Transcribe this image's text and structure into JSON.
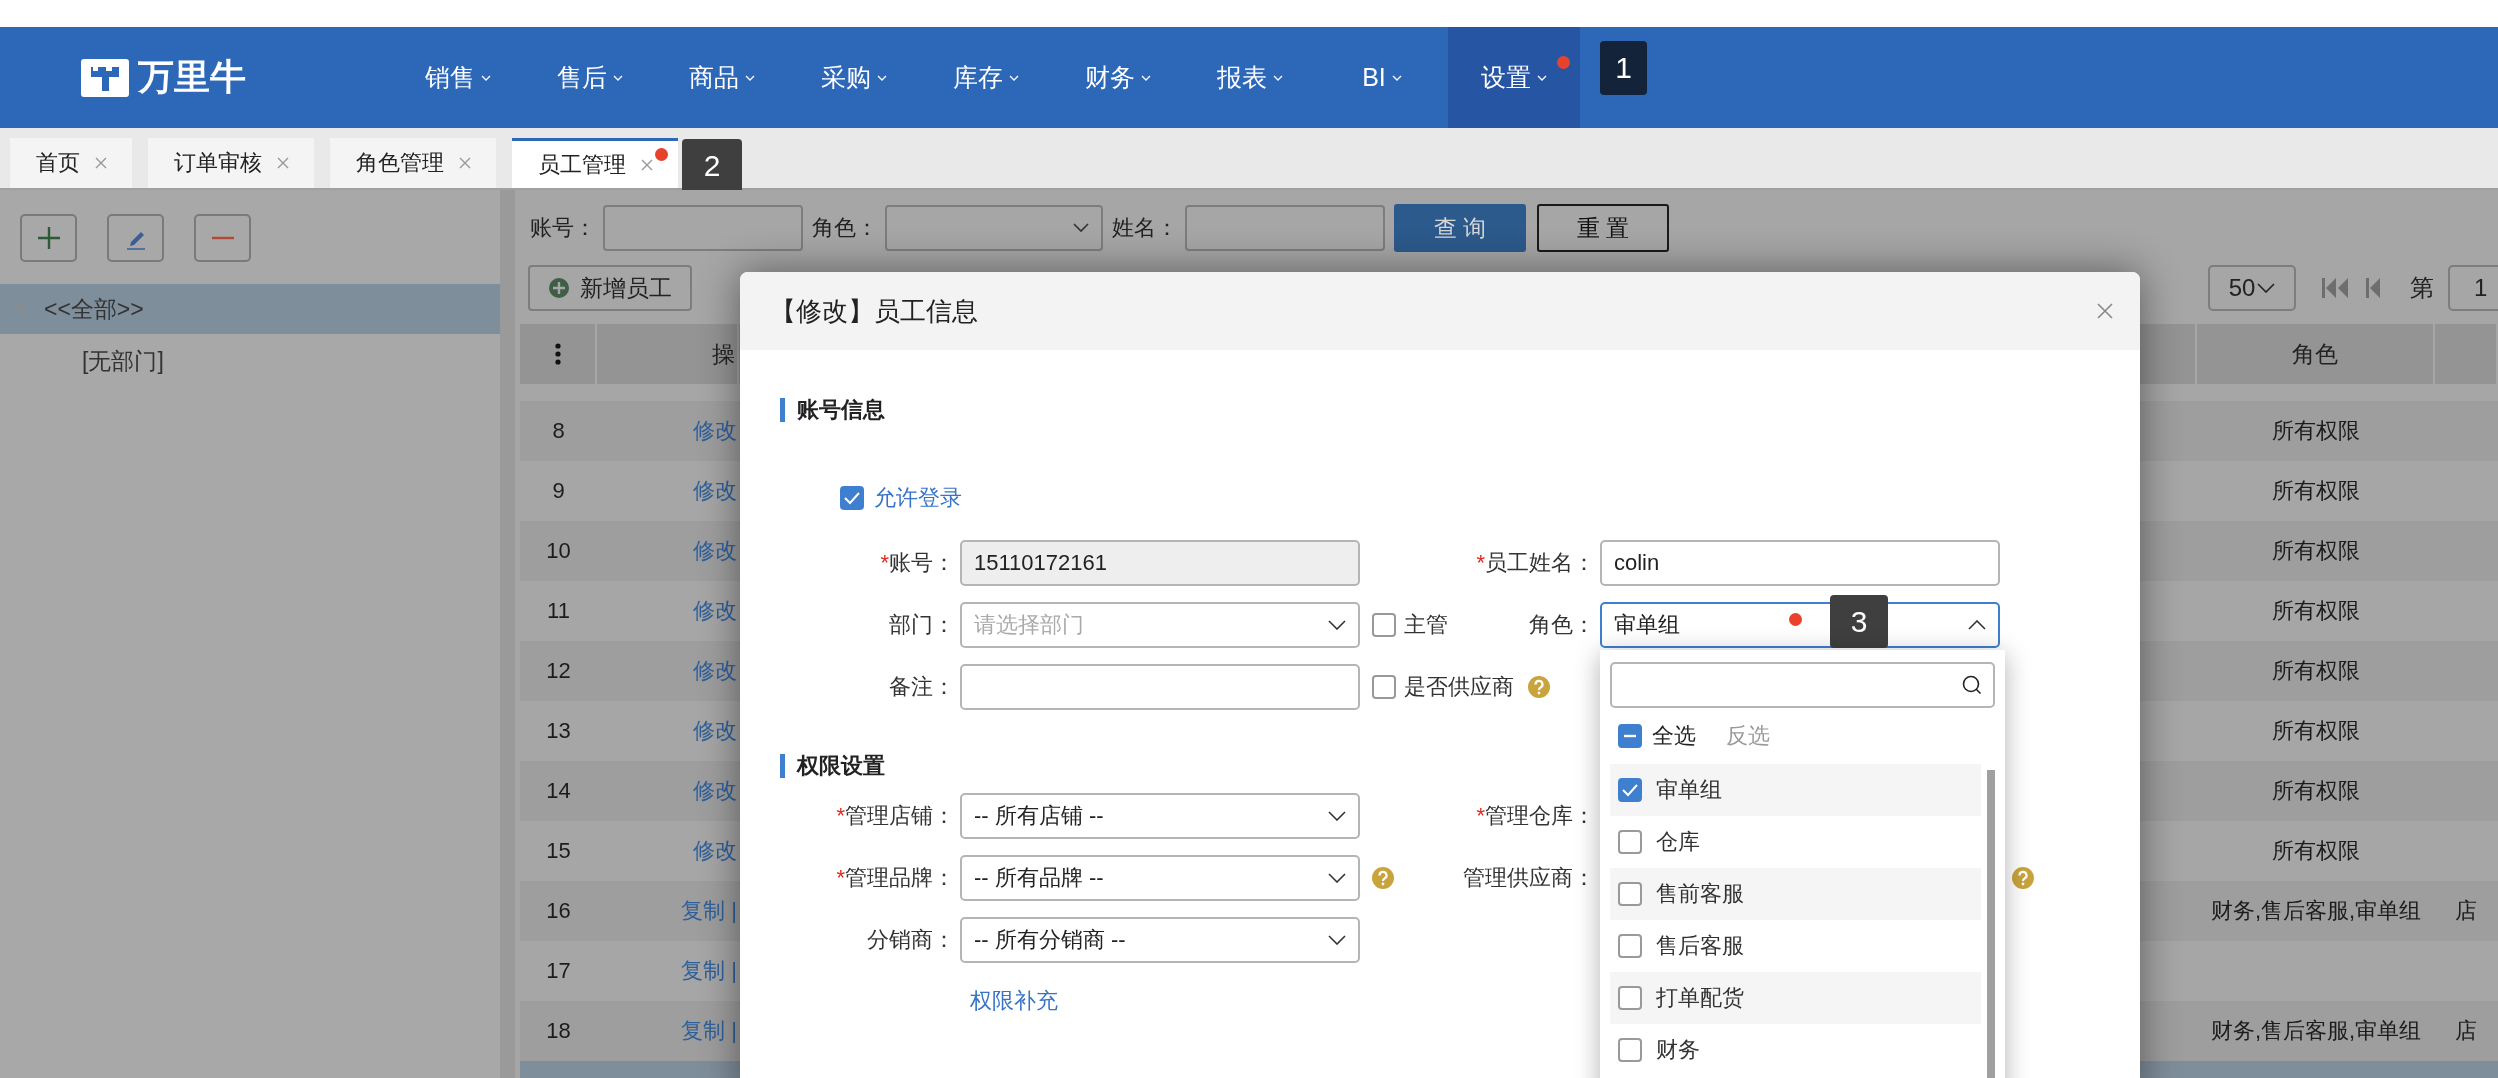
{
  "nav": {
    "logo": "万里牛",
    "items": [
      {
        "label": "销售",
        "selected": false
      },
      {
        "label": "售后",
        "selected": false
      },
      {
        "label": "商品",
        "selected": false
      },
      {
        "label": "采购",
        "selected": false
      },
      {
        "label": "库存",
        "selected": false
      },
      {
        "label": "财务",
        "selected": false
      },
      {
        "label": "报表",
        "selected": false
      },
      {
        "label": "BI",
        "selected": false
      },
      {
        "label": "设置",
        "selected": true,
        "dot": true,
        "callout": "1"
      }
    ]
  },
  "tabs": [
    {
      "label": "首页",
      "selected": false
    },
    {
      "label": "订单审核",
      "selected": false
    },
    {
      "label": "角色管理",
      "selected": false
    },
    {
      "label": "员工管理",
      "selected": true,
      "dot": true,
      "callout": "2"
    }
  ],
  "tree": [
    {
      "label": "<<全部>>",
      "selected": true,
      "expanded": true,
      "children": [
        {
          "label": "[无部门]",
          "selected": false
        }
      ]
    }
  ],
  "filters": {
    "account_label": "账号：",
    "role_label": "角色：",
    "name_label": "姓名：",
    "search_button": "查 询",
    "reset_button": "重 置"
  },
  "toolbar": {
    "add_button": "新增员工",
    "page_size": "50",
    "page_label": "第",
    "page_value": "1"
  },
  "table": {
    "columns": [
      "操",
      "角色"
    ],
    "rows": [
      {
        "index": "8",
        "actions": "修改",
        "role": "所有权限",
        "selected": false
      },
      {
        "index": "9",
        "actions": "修改",
        "role": "所有权限",
        "selected": false
      },
      {
        "index": "10",
        "actions": "修改",
        "role": "所有权限",
        "selected": false
      },
      {
        "index": "11",
        "actions": "修改",
        "role": "所有权限",
        "selected": false
      },
      {
        "index": "12",
        "actions": "修改",
        "role": "所有权限",
        "selected": false
      },
      {
        "index": "13",
        "actions": "修改",
        "role": "所有权限",
        "selected": false
      },
      {
        "index": "14",
        "actions": "修改",
        "role": "所有权限",
        "selected": false
      },
      {
        "index": "15",
        "actions": "修改",
        "role": "所有权限",
        "selected": false
      },
      {
        "index": "16",
        "actions": "复制 |",
        "role": "财务,售后客服,审单组",
        "column_5": "店",
        "selected": false
      },
      {
        "index": "17",
        "actions": "复制 |",
        "selected": false
      },
      {
        "index": "18",
        "actions": "复制 |",
        "role": "财务,售后客服,审单组",
        "column_5": "店",
        "selected": false
      },
      {
        "selected": true
      }
    ]
  },
  "dialog": {
    "title": "【修改】员工信息",
    "sections": [
      {
        "title": "账号信息",
        "login": {
          "label": "允许登录",
          "checked": true
        },
        "rows": [
          {
            "left": {
              "mark": "*",
              "label": "账号：",
              "kind": "input",
              "value": "15110172161",
              "disabled": true
            },
            "right": {
              "mark": "*",
              "label": "员工姓名：",
              "kind": "input",
              "value": "colin",
              "disabled": false
            }
          },
          {
            "left": {
              "label": "部门：",
              "kind": "select",
              "placeholder": "请选择部门"
            },
            "extra": {
              "kind": "checkbox",
              "label": "主管",
              "checked": false
            },
            "right": {
              "label": "角色：",
              "kind": "select",
              "value": "审单组",
              "open": true,
              "dot": true,
              "callout": "3"
            }
          },
          {
            "left": {
              "label": "备注：",
              "kind": "input",
              "disabled": false
            },
            "extra": {
              "kind": "checkbox",
              "label": "是否供应商",
              "checked": false,
              "help": true
            }
          }
        ]
      },
      {
        "title": "权限设置",
        "rows": [
          {
            "left": {
              "mark": "*",
              "label": "管理店铺：",
              "kind": "select",
              "value": "-- 所有店铺 --"
            },
            "right": {
              "mark": "*",
              "label": "管理仓库："
            }
          },
          {
            "left": {
              "mark": "*",
              "label": "管理品牌：",
              "kind": "select",
              "value": "-- 所有品牌 --"
            },
            "extra": {
              "kind": "help"
            },
            "right": {
              "label": "管理供应商：",
              "help": true
            }
          },
          {
            "left": {
              "label": "分销商：",
              "kind": "select",
              "value": "-- 所有分销商 --"
            }
          }
        ],
        "link": "权限补充"
      }
    ],
    "dropdown": {
      "select_all": {
        "label": "全选",
        "indeterminate": true
      },
      "invert": "反选",
      "options": [
        {
          "label": "审单组",
          "checked": true
        },
        {
          "label": "仓库",
          "checked": false
        },
        {
          "label": "售前客服",
          "checked": false
        },
        {
          "label": "售后客服",
          "checked": false
        },
        {
          "label": "打单配货",
          "checked": false
        },
        {
          "label": "财务",
          "checked": false
        }
      ]
    }
  }
}
